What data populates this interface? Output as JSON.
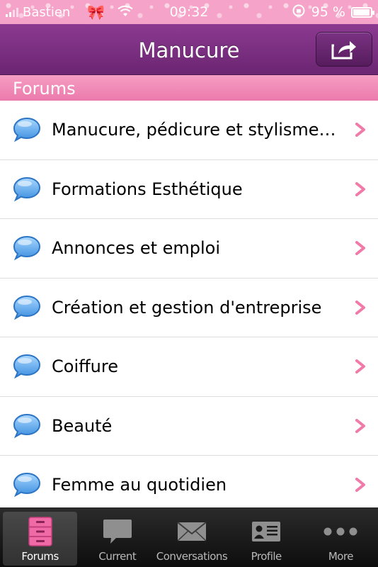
{
  "status_bar": {
    "carrier": "Bastien",
    "time": "09:32",
    "battery": "95 %",
    "battery_level": 0.95
  },
  "nav": {
    "title": "Manucure"
  },
  "section": {
    "title": "Forums"
  },
  "forums": [
    "Manucure, pédicure et stylisme…",
    "Formations Esthétique",
    "Annonces et emploi",
    "Création et gestion d'entreprise",
    "Coiffure",
    "Beauté",
    "Femme au quotidien"
  ],
  "tabs": [
    {
      "label": "Forums",
      "icon": "cabinet-icon",
      "active": true
    },
    {
      "label": "Current",
      "icon": "speech-bubble-icon",
      "active": false
    },
    {
      "label": "Conversations",
      "icon": "envelope-icon",
      "active": false
    },
    {
      "label": "Profile",
      "icon": "profile-card-icon",
      "active": false
    },
    {
      "label": "More",
      "icon": "more-dots-icon",
      "active": false
    }
  ],
  "colors": {
    "nav_purple": "#7a2f80",
    "section_pink": "#f08cb8",
    "chevron_pink": "#f07aa8",
    "bubble_blue": "#3d8fe0"
  }
}
